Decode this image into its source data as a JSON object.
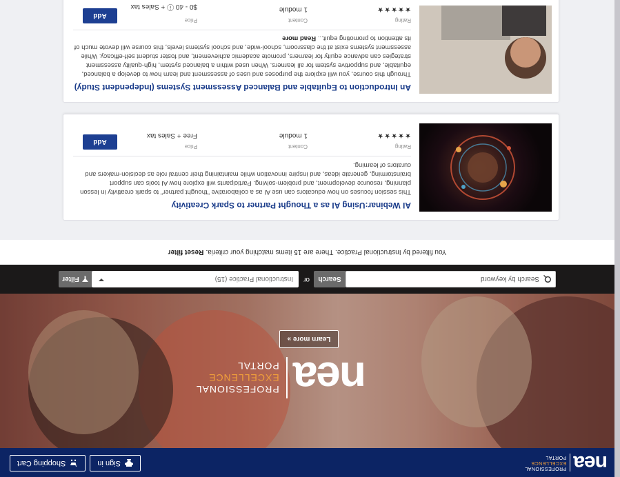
{
  "header": {
    "brand_nea": "nea",
    "brand_line1": "PROFESSIONAL",
    "brand_line2": "EXCELLENCE",
    "brand_line3": "PORTAL",
    "sign_in": "Sign in",
    "cart": "Shopping Cart"
  },
  "hero": {
    "logo_nea": "nea",
    "line1": "PROFESSIONAL",
    "line2": "EXCELLENCE",
    "line3": "PORTAL",
    "learn_more": "Learn more »"
  },
  "search": {
    "placeholder": "Search by keyword",
    "button": "Search",
    "or": "or",
    "selected": "Instructional Practice (15)",
    "filter": "Filter"
  },
  "notice": {
    "text": "You filtered by Instructional Practice. There are 15 items matching your criteria.",
    "reset": "Reset filter"
  },
  "courses": [
    {
      "title": "AI Webinar:Using AI as a Thought Partner to Spark Creativity",
      "description": "This session focuses on how educators can use AI as a collaborative \"thought partner\" to spark creativity in lesson planning, resource development, and problem-solving. Participants will explore how AI tools can support brainstorming, generate ideas, and inspire innovation while maintaining their central role as decision-makers and curators of learning.",
      "more": "",
      "rating_label": "Rating",
      "stars": "★★★★★",
      "content_label": "Content",
      "content_value": "1 module",
      "price_label": "Price",
      "price_value": "Free  + Sales tax",
      "add": "Add"
    },
    {
      "title": "An Introduction to Equitable and Balanced Assessment Systems (Independent Study)",
      "description": "Through this course, you will explore the purposes and uses of assessment and learn how to develop a balanced, equitable, and supportive system for all learners. When used within a balanced system, high-quality assessment strategies can advance equity for learners, promote academic achievement, and foster student self-efficacy. While assessment systems exist at the classroom, school-wide, and school systems levels, this course will devote much of its attention to promoting equit...",
      "more": "Read more",
      "rating_label": "Rating",
      "stars": "★★★★★",
      "content_label": "Content",
      "content_value": "1 module",
      "price_label": "Price",
      "price_value": "$0 - 40 ⓘ + Sales tax",
      "add": "Add"
    }
  ],
  "colors": {
    "navy": "#0c2464",
    "accent": "#f2a03a",
    "button_blue": "#1d3f92",
    "star": "#e0a12a"
  }
}
